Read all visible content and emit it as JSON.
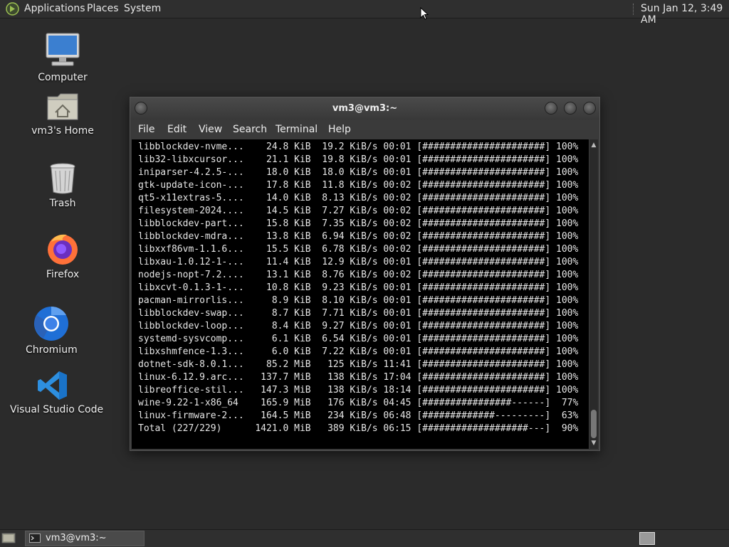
{
  "top_panel": {
    "menus": [
      "Applications",
      "Places",
      "System"
    ],
    "clock": "Sun Jan 12,  3:49 AM"
  },
  "desktop_icons": [
    {
      "label": "Computer",
      "icon": "computer-icon"
    },
    {
      "label": "vm3's Home",
      "icon": "home-folder-icon"
    },
    {
      "label": "Trash",
      "icon": "trash-icon"
    },
    {
      "label": "Firefox",
      "icon": "firefox-icon"
    },
    {
      "label": "Chromium",
      "icon": "chromium-icon"
    },
    {
      "label": "Visual Studio Code",
      "icon": "vscode-icon"
    }
  ],
  "window": {
    "title": "vm3@vm3:~",
    "menus": [
      "File",
      "Edit",
      "View",
      "Search",
      "Terminal",
      "Help"
    ]
  },
  "terminal": {
    "lines": [
      "libblockdev-nvme...    24.8 KiB  19.2 KiB/s 00:01 [######################] 100%",
      "lib32-libxcursor...    21.1 KiB  19.8 KiB/s 00:01 [######################] 100%",
      "iniparser-4.2.5-...    18.0 KiB  18.0 KiB/s 00:01 [######################] 100%",
      "gtk-update-icon-...    17.8 KiB  11.8 KiB/s 00:02 [######################] 100%",
      "qt5-x11extras-5....    14.0 KiB  8.13 KiB/s 00:02 [######################] 100%",
      "filesystem-2024....    14.5 KiB  7.27 KiB/s 00:02 [######################] 100%",
      "libblockdev-part...    15.8 KiB  7.35 KiB/s 00:02 [######################] 100%",
      "libblockdev-mdra...    13.8 KiB  6.94 KiB/s 00:02 [######################] 100%",
      "libxxf86vm-1.1.6...    15.5 KiB  6.78 KiB/s 00:02 [######################] 100%",
      "libxau-1.0.12-1-...    11.4 KiB  12.9 KiB/s 00:01 [######################] 100%",
      "nodejs-nopt-7.2....    13.1 KiB  8.76 KiB/s 00:02 [######################] 100%",
      "libxcvt-0.1.3-1-...    10.8 KiB  9.23 KiB/s 00:01 [######################] 100%",
      "pacman-mirrorlis...     8.9 KiB  8.10 KiB/s 00:01 [######################] 100%",
      "libblockdev-swap...     8.7 KiB  7.71 KiB/s 00:01 [######################] 100%",
      "libblockdev-loop...     8.4 KiB  9.27 KiB/s 00:01 [######################] 100%",
      "systemd-sysvcomp...     6.1 KiB  6.54 KiB/s 00:01 [######################] 100%",
      "libxshmfence-1.3...     6.0 KiB  7.22 KiB/s 00:01 [######################] 100%",
      "dotnet-sdk-8.0.1...    85.2 MiB   125 KiB/s 11:41 [######################] 100%",
      "linux-6.12.9.arc...   137.7 MiB   138 KiB/s 17:04 [######################] 100%",
      "libreoffice-stil...   147.3 MiB   138 KiB/s 18:14 [######################] 100%",
      "wine-9.22-1-x86_64    165.9 MiB   176 KiB/s 04:45 [################------]  77%",
      "linux-firmware-2...   164.5 MiB   234 KiB/s 06:48 [#############---------]  63%",
      "Total (227/229)      1421.0 MiB   389 KiB/s 06:15 [###################---]  90%"
    ]
  },
  "taskbar": {
    "task_label": "vm3@vm3:~"
  }
}
